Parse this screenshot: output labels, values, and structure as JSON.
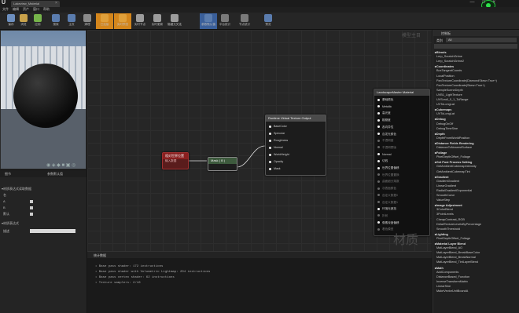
{
  "app": {
    "logo": "U",
    "tab_title": "Lakeview_Material",
    "tab_close": "×",
    "window_controls": "—  □  ×"
  },
  "menu": [
    "文件",
    "编辑",
    "资产",
    "窗口",
    "帮助"
  ],
  "toolbar": [
    {
      "label": "保存",
      "icon": "save-icon",
      "color": "#6d8fbf"
    },
    {
      "label": "浏览",
      "icon": "browse-icon",
      "color": "#c9a24a"
    },
    {
      "label": "应用",
      "icon": "apply-icon",
      "color": "#76b44a"
    },
    {
      "label": "搜索",
      "icon": "search-icon",
      "color": "#5a7cae"
    },
    {
      "label": "主页",
      "icon": "home-icon",
      "color": "#5a7cae"
    },
    {
      "label": "清理",
      "icon": "clean-icon",
      "color": "#8a8a8a"
    },
    {
      "label": "已连接",
      "icon": "connectors-icon",
      "color": "#e0a03a",
      "active": true
    },
    {
      "label": "实时预览",
      "icon": "live-preview-icon",
      "color": "#e0a03a",
      "active": true
    },
    {
      "label": "实时节点",
      "icon": "live-nodes-icon",
      "color": "#9c9c9c"
    },
    {
      "label": "实时更新",
      "icon": "live-update-icon",
      "color": "#9c9c9c"
    },
    {
      "label": "隐藏无关连",
      "icon": "hide-icon",
      "color": "#9c9c9c"
    },
    {
      "label": "参数默认值",
      "icon": "params-icon",
      "color": "#5a7cae",
      "active_blue": true
    },
    {
      "label": "平台统计",
      "icon": "stats-icon",
      "color": "#7a7a7a"
    },
    {
      "label": "节点统计",
      "icon": "node-stats-icon",
      "color": "#7a7a7a"
    },
    {
      "label": "预览",
      "icon": "preview-icon",
      "color": "#5a7cae"
    }
  ],
  "viewport": {
    "bottom_icons": "◉ ◈ ◆ ■ ▣ ◎"
  },
  "details": {
    "tabs": [
      "细节",
      "参数默认值"
    ],
    "section1": "▾材质表达式读取数据",
    "rows": [
      {
        "label": "名"
      },
      {
        "label": "A"
      },
      {
        "label": "B"
      },
      {
        "label": "默认"
      }
    ],
    "section2": "▾材质表达式",
    "desc_label": "描述"
  },
  "graph": {
    "watermark": "模型主目",
    "watermark_big": "材质",
    "nodes": {
      "red": {
        "title": "相对世界位置",
        "subtitle": "输入数据"
      },
      "mask": {
        "title": "Mask ( B )"
      },
      "rvt": {
        "title": "Runtime Virtual Texture Output",
        "pins": [
          "BaseColor",
          "Specular",
          "Roughness",
          "Normal",
          "WorldHeight",
          "Opacity",
          "Mask"
        ]
      },
      "main": {
        "title": "LandscapeMaster Material",
        "pins": [
          {
            "t": "基础颜色",
            "dim": false
          },
          {
            "t": "Metallic",
            "dim": false
          },
          {
            "t": "高光度",
            "dim": false
          },
          {
            "t": "粗糙度",
            "dim": false
          },
          {
            "t": "各向异性",
            "dim": false
          },
          {
            "t": "自发光颜色",
            "dim": false
          },
          {
            "t": "不透明度",
            "dim": true
          },
          {
            "t": "不透明蒙版",
            "dim": true
          },
          {
            "t": "Normal",
            "dim": false
          },
          {
            "t": "切线",
            "dim": false
          },
          {
            "t": "世界位置偏移",
            "dim": false
          },
          {
            "t": "世界位置置换",
            "dim": true
          },
          {
            "t": "曲面细分乘数",
            "dim": true
          },
          {
            "t": "次表面颜色",
            "dim": true
          },
          {
            "t": "自定义数据0",
            "dim": true
          },
          {
            "t": "自定义数据1",
            "dim": true
          },
          {
            "t": "环境光遮挡",
            "dim": false
          },
          {
            "t": "折射",
            "dim": true
          },
          {
            "t": "像素深度偏移",
            "dim": false
          },
          {
            "t": "着色模型",
            "dim": true
          }
        ]
      }
    }
  },
  "stats": {
    "tab": "统计数据",
    "lines": [
      "• Base pass shader: 172 instructions",
      "• Base pass shader with Volumetric Lightmap: 204 instructions",
      "• Base pass vertex shader: 62 instructions",
      "• Texture samplers: 2/16"
    ]
  },
  "palette": {
    "title": "控制板",
    "category_label": "类别",
    "category_value": "All",
    "items": [
      {
        "t": "▸Blends",
        "cat": true
      },
      {
        "t": "Lerp_ScratchGrime",
        "cat": false
      },
      {
        "t": "Lerp_ScratchGrime2",
        "cat": false
      },
      {
        "t": "▸Coordinates",
        "cat": true
      },
      {
        "t": "BoxTangentCoords",
        "cat": false
      },
      {
        "t": "LocalPosition",
        "cat": false
      },
      {
        "t": "PanTextureCoordinate(DiamondSkew=True+)",
        "cat": false
      },
      {
        "t": "PanTextureCoordinate(Skew=True+)",
        "cat": false
      },
      {
        "t": "SampleSceneDepth",
        "cat": false
      },
      {
        "t": "UVB1_LightTexture",
        "cat": false
      },
      {
        "t": "UVScroll_0_1_ToRange",
        "cat": false
      },
      {
        "t": "UVToLongLat",
        "cat": false
      },
      {
        "t": "▸Cubemaps",
        "cat": true
      },
      {
        "t": "UVToLongLat",
        "cat": false
      },
      {
        "t": "▸Debug",
        "cat": true
      },
      {
        "t": "DebugOnOff",
        "cat": false
      },
      {
        "t": "DebugTimeSine",
        "cat": false
      },
      {
        "t": "▸Depth",
        "cat": true
      },
      {
        "t": "DepthFromWorldPosition",
        "cat": false
      },
      {
        "t": "▸Distance Fields Rendering",
        "cat": true
      },
      {
        "t": "DistanceToNearestSurface",
        "cat": false
      },
      {
        "t": "▸Foliage",
        "cat": true
      },
      {
        "t": "PixelDepthOffset_Foliage",
        "cat": false
      },
      {
        "t": "▸Get Post Process Setting",
        "cat": true
      },
      {
        "t": "GetAmbientCubemapIntensity",
        "cat": false
      },
      {
        "t": "GetAmbientCubemapTint",
        "cat": false
      },
      {
        "t": "▸Gradient",
        "cat": true
      },
      {
        "t": "GradientGradient",
        "cat": false
      },
      {
        "t": "LinearGradient",
        "cat": false
      },
      {
        "t": "RadialGradientExponential",
        "cat": false
      },
      {
        "t": "SmoothCurve",
        "cat": false
      },
      {
        "t": "ValueStep",
        "cat": false
      },
      {
        "t": "▸Image Adjustment",
        "cat": true
      },
      {
        "t": "3ColorBlend",
        "cat": false
      },
      {
        "t": "3PointLevels",
        "cat": false
      },
      {
        "t": "CheapContrast_RGB",
        "cat": false
      },
      {
        "t": "DetailTextureLevelsByPercentage",
        "cat": false
      },
      {
        "t": "SmoothThreshold",
        "cat": false
      },
      {
        "t": "▸Lighting",
        "cat": true
      },
      {
        "t": "PixelDepthOffset_Foliage",
        "cat": false
      },
      {
        "t": "▸Material Layer Blend",
        "cat": true
      },
      {
        "t": "MatLayerBlend_AO",
        "cat": false
      },
      {
        "t": "MatLayerBlend_BreakBaseColor",
        "cat": false
      },
      {
        "t": "MatLayerBlend_BreakNormal",
        "cat": false
      },
      {
        "t": "MatLayerBlend_TintLayerBlend",
        "cat": false
      },
      {
        "t": "▸Math",
        "cat": true
      },
      {
        "t": "AddComponents",
        "cat": false
      },
      {
        "t": "DistanceBased_Function",
        "cat": false
      },
      {
        "t": "InverseTransformMatrix",
        "cat": false
      },
      {
        "t": "LinearSine",
        "cat": false
      },
      {
        "t": "MakeVectorUnitBoundA",
        "cat": false
      }
    ]
  }
}
